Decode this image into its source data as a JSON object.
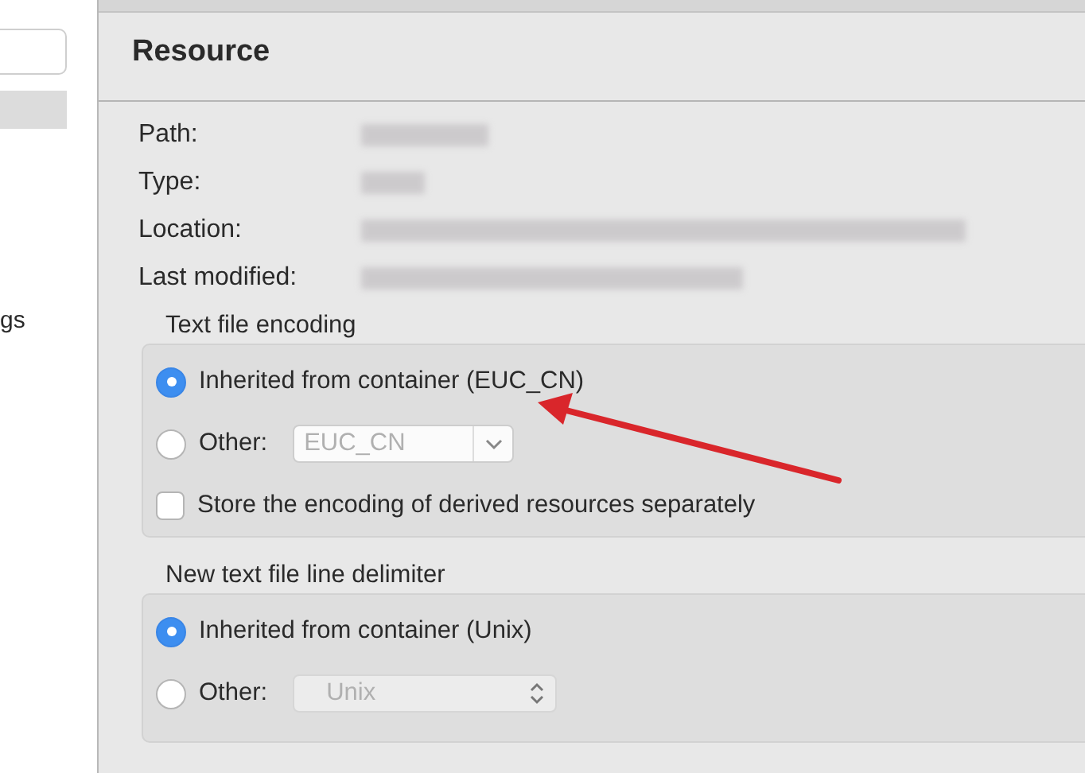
{
  "sidebar": {
    "items": [
      {
        "label": "gs"
      }
    ]
  },
  "panel": {
    "title": "Resource",
    "info": [
      {
        "label": "Path:"
      },
      {
        "label": "Type:"
      },
      {
        "label": "Location:"
      },
      {
        "label": "Last modified:"
      }
    ],
    "groups": [
      {
        "title": "Text file encoding",
        "options": [
          {
            "kind": "radio",
            "label": "Inherited from container (EUC_CN)",
            "selected": true
          },
          {
            "kind": "radio-combo",
            "label": "Other:",
            "selected": false,
            "combo": {
              "value": "EUC_CN",
              "disabled": true,
              "kind": "dropdown"
            }
          },
          {
            "kind": "checkbox",
            "label": "Store the encoding of derived resources separately",
            "checked": false
          }
        ]
      },
      {
        "title": "New text file line delimiter",
        "options": [
          {
            "kind": "radio",
            "label": "Inherited from container (Unix)",
            "selected": true
          },
          {
            "kind": "radio-combo",
            "label": "Other:",
            "selected": false,
            "combo": {
              "value": "Unix",
              "disabled": true,
              "kind": "popup"
            }
          }
        ]
      }
    ]
  },
  "annotation": {
    "kind": "arrow"
  }
}
